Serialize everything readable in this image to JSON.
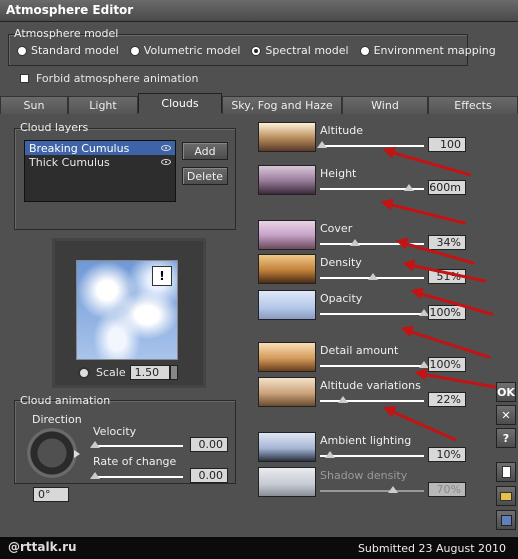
{
  "window": {
    "title": "Atmosphere Editor"
  },
  "atmosphere_model": {
    "group_label": "Atmosphere model",
    "options": [
      "Standard model",
      "Volumetric model",
      "Spectral model",
      "Environment mapping"
    ],
    "selected": "Spectral model"
  },
  "forbid_animation": {
    "label": "Forbid atmosphere animation",
    "checked": false
  },
  "tabs": [
    "Sun",
    "Light",
    "Clouds",
    "Sky, Fog and Haze",
    "Wind",
    "Effects"
  ],
  "active_tab": "Clouds",
  "cloud_layers": {
    "group_label": "Cloud layers",
    "items": [
      {
        "label": "Breaking Cumulus",
        "selected": true,
        "icon": "eye-icon"
      },
      {
        "label": "Thick Cumulus",
        "selected": false,
        "icon": "eye-icon"
      }
    ],
    "add_label": "Add",
    "delete_label": "Delete"
  },
  "preview": {
    "warning_glyph": "!",
    "scale_label": "Scale",
    "scale_value": "1.50"
  },
  "cloud_animation": {
    "group_label": "Cloud animation",
    "direction_label": "Direction",
    "direction_value": "0°",
    "velocity_label": "Velocity",
    "velocity_value": "0.00",
    "rate_label": "Rate of change",
    "rate_value": "0.00"
  },
  "params": [
    {
      "label": "Altitude",
      "value": "100",
      "level": 0.02
    },
    {
      "label": "Height",
      "value": "600m",
      "level": 0.86
    },
    {
      "label": "Cover",
      "value": "34%",
      "level": 0.34
    },
    {
      "label": "Density",
      "value": "51%",
      "level": 0.51
    },
    {
      "label": "Opacity",
      "value": "100%",
      "level": 1.0
    },
    {
      "label": "Detail amount",
      "value": "100%",
      "level": 1.0
    },
    {
      "label": "Altitude variations",
      "value": "22%",
      "level": 0.22
    },
    {
      "label": "Ambient lighting",
      "value": "10%",
      "level": 0.1
    },
    {
      "label": "Shadow density",
      "value": "70%",
      "level": 0.7,
      "disabled": true
    }
  ],
  "side_buttons": [
    "OK",
    "✕",
    "?"
  ],
  "footer": {
    "logo": "@rttalk.ru",
    "submitted": "Submitted 23 August 2010"
  },
  "colors": {
    "panel": "#505050",
    "selection": "#3e63a8",
    "annotation_arrow": "#c51212"
  }
}
